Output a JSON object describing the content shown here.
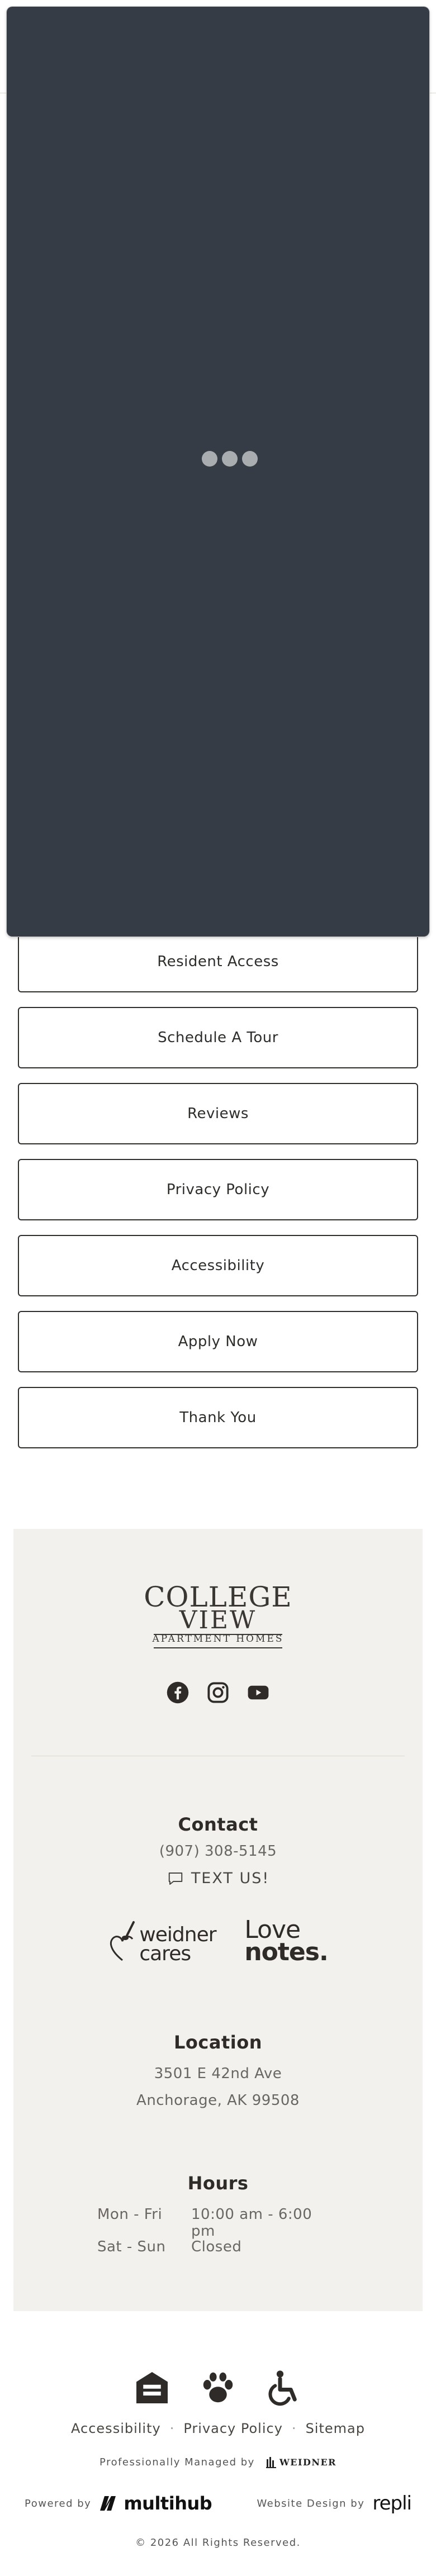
{
  "nav_buttons": [
    {
      "label": "Resident Access"
    },
    {
      "label": "Schedule A Tour"
    },
    {
      "label": "Reviews"
    },
    {
      "label": "Privacy Policy"
    },
    {
      "label": "Accessibility"
    },
    {
      "label": "Apply Now"
    },
    {
      "label": "Thank You"
    }
  ],
  "logo": {
    "line1": "COLLEGE",
    "line2": "VIEW",
    "line3": "APARTMENT HOMES"
  },
  "social": [
    "facebook-icon",
    "instagram-icon",
    "youtube-icon"
  ],
  "contact": {
    "heading": "Contact",
    "phone": "(907) 308-5145",
    "text_us": "TEXT US!"
  },
  "brands": {
    "weidner_cares": "weidner cares",
    "love_notes_1": "Love",
    "love_notes_2": "notes."
  },
  "location": {
    "heading": "Location",
    "address_line1": "3501 E 42nd Ave",
    "address_line2": "Anchorage, AK 99508"
  },
  "hours": {
    "heading": "Hours",
    "rows": [
      {
        "days": "Mon - Fri",
        "time": "10:00 am - 6:00 pm"
      },
      {
        "days": "Sat - Sun",
        "time": "Closed"
      }
    ]
  },
  "footer": {
    "icons": [
      "equal-housing-icon",
      "pet-friendly-icon",
      "accessibility-icon"
    ],
    "links": [
      "Accessibility",
      "Privacy Policy",
      "Sitemap"
    ],
    "managed_label": "Professionally Managed by",
    "managed_brand": "WEIDNER",
    "powered_label": "Powered by",
    "powered_brand": "multihub",
    "design_label": "Website Design by",
    "design_brand": "repli",
    "copyright": "© 2026 All Rights Reserved."
  },
  "colors": {
    "overlay": "#353c45",
    "footer_panel": "#f2f1ed",
    "text_dark": "#2e2b28",
    "text_muted": "#6a6762"
  }
}
